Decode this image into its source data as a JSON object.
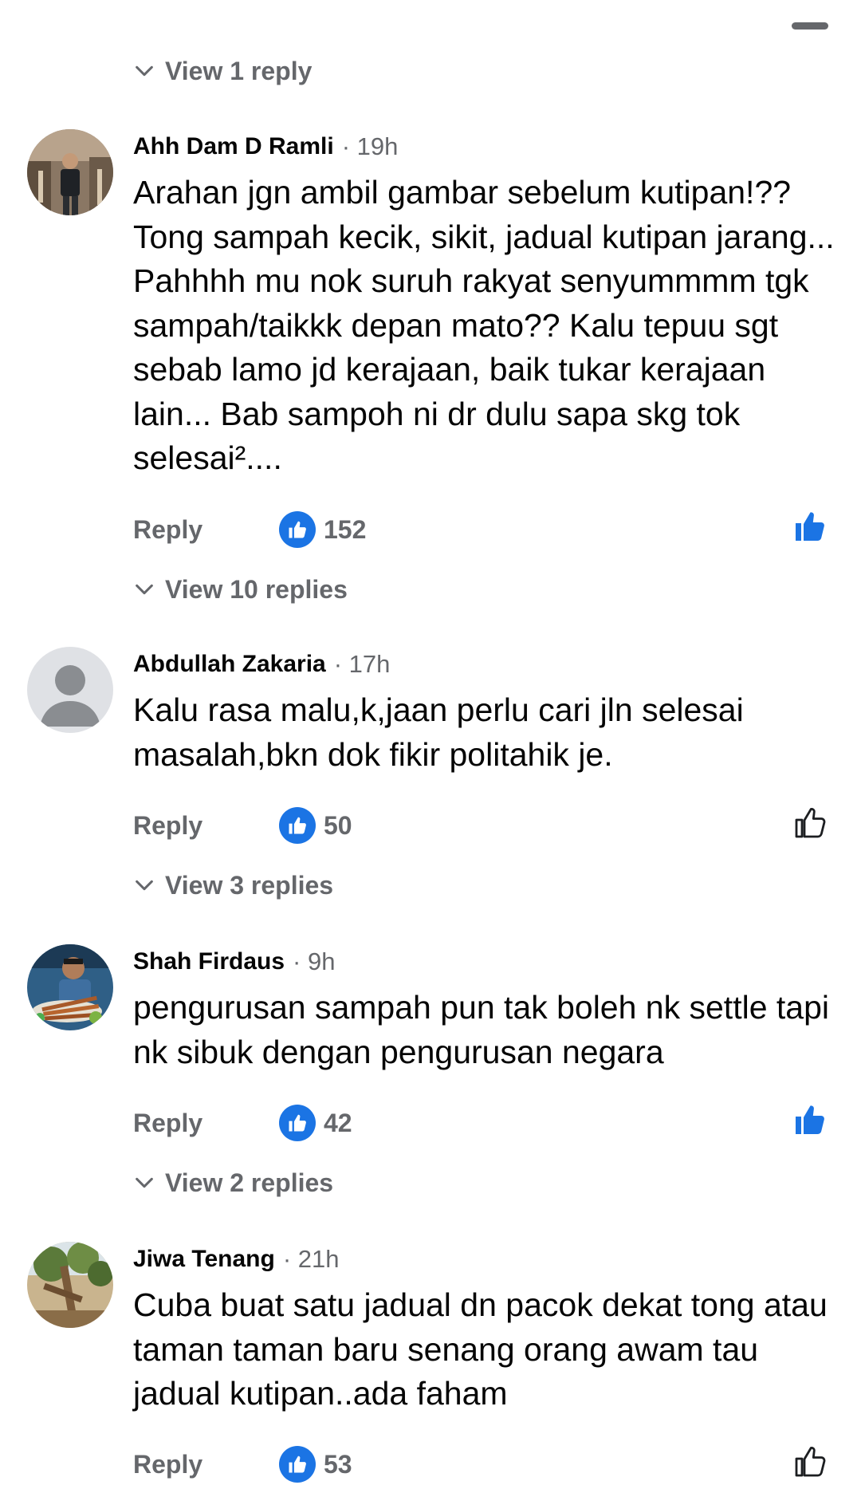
{
  "top_reply_link": "View 1 reply",
  "comments": [
    {
      "author": "Ahh Dam D Ramli",
      "time": "· 19h",
      "text": "Arahan jgn ambil gambar sebelum kutipan!?? Tong sampah kecik, sikit, jadual kutipan jarang... Pahhhh mu nok suruh rakyat senyummmm tgk sampah/taikkk depan mato?? Kalu tepuu sgt sebab lamo jd kerajaan, baik tukar kerajaan lain... Bab sampoh ni dr dulu sapa skg tok selesai².... ",
      "reply_label": "Reply",
      "like_count": "152",
      "liked": true,
      "view_replies": "View 10 replies"
    },
    {
      "author": "Abdullah Zakaria",
      "time": "· 17h",
      "text": "Kalu rasa malu,k,jaan perlu cari jln selesai masalah,bkn dok fikir politahik je.",
      "reply_label": "Reply",
      "like_count": "50",
      "liked": false,
      "view_replies": "View 3 replies"
    },
    {
      "author": "Shah Firdaus",
      "time": "· 9h",
      "text": "pengurusan sampah pun tak boleh nk settle tapi nk sibuk dengan pengurusan negara",
      "reply_label": "Reply",
      "like_count": "42",
      "liked": true,
      "view_replies": "View 2 replies"
    },
    {
      "author": "Jiwa Tenang",
      "time": "· 21h",
      "text": "Cuba buat satu jadual dn pacok dekat tong atau taman taman baru senang orang awam tau jadual kutipan..ada faham",
      "reply_label": "Reply",
      "like_count": "53",
      "liked": false
    }
  ],
  "icons": {
    "chevron": "chevron-down-icon",
    "like_badge": "thumbs-up-icon",
    "like_toggle": "thumbs-up-outline-icon"
  },
  "colors": {
    "accent": "#1b74e4",
    "secondary_text": "#65676b",
    "primary_text": "#050505"
  }
}
